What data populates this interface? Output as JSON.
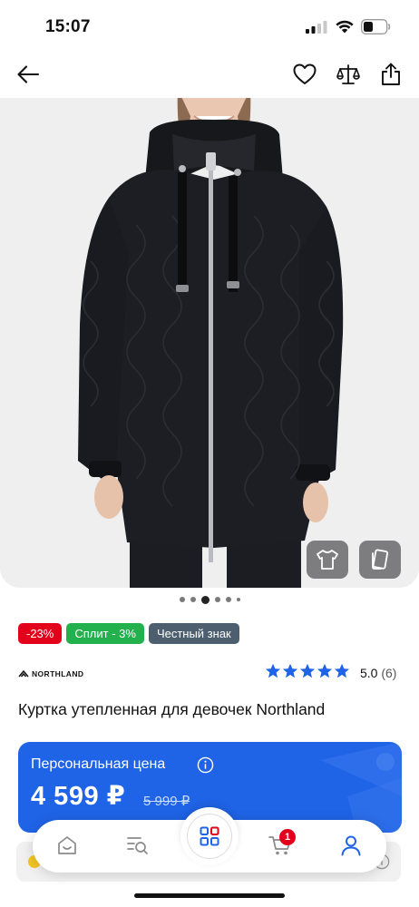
{
  "status_bar": {
    "time": "15:07"
  },
  "nav": {
    "back_icon": "arrow-left-icon",
    "favorite_icon": "heart-icon",
    "compare_icon": "scales-icon",
    "share_icon": "share-icon"
  },
  "gallery": {
    "image_subject": "black quilted hooded parka",
    "buttons": [
      "tshirt-icon",
      "cards-icon"
    ],
    "dots_count": 6,
    "active_dot": 2
  },
  "badges": [
    {
      "label": "-23%",
      "color": "#e3001b"
    },
    {
      "label": "Сплит - 3%",
      "color": "#23b14d"
    },
    {
      "label": "Честный знак",
      "color": "#4d5e6e"
    }
  ],
  "product": {
    "brand": "NORTHLAND",
    "rating": "5.0",
    "reviews": "(6)",
    "stars": 5,
    "title": "Куртка утепленная для девочек Northland"
  },
  "price": {
    "label": "Персональная цена",
    "current": "4 599 ₽",
    "old": "5 999 ₽"
  },
  "tab_bar": {
    "tabs": [
      "home-icon",
      "search-list-icon",
      "catalog-icon",
      "cart-icon",
      "profile-icon"
    ],
    "cart_count": "1"
  },
  "colors": {
    "accent": "#1f63e6",
    "star": "#1f63e6",
    "badge_red": "#e3001b"
  }
}
